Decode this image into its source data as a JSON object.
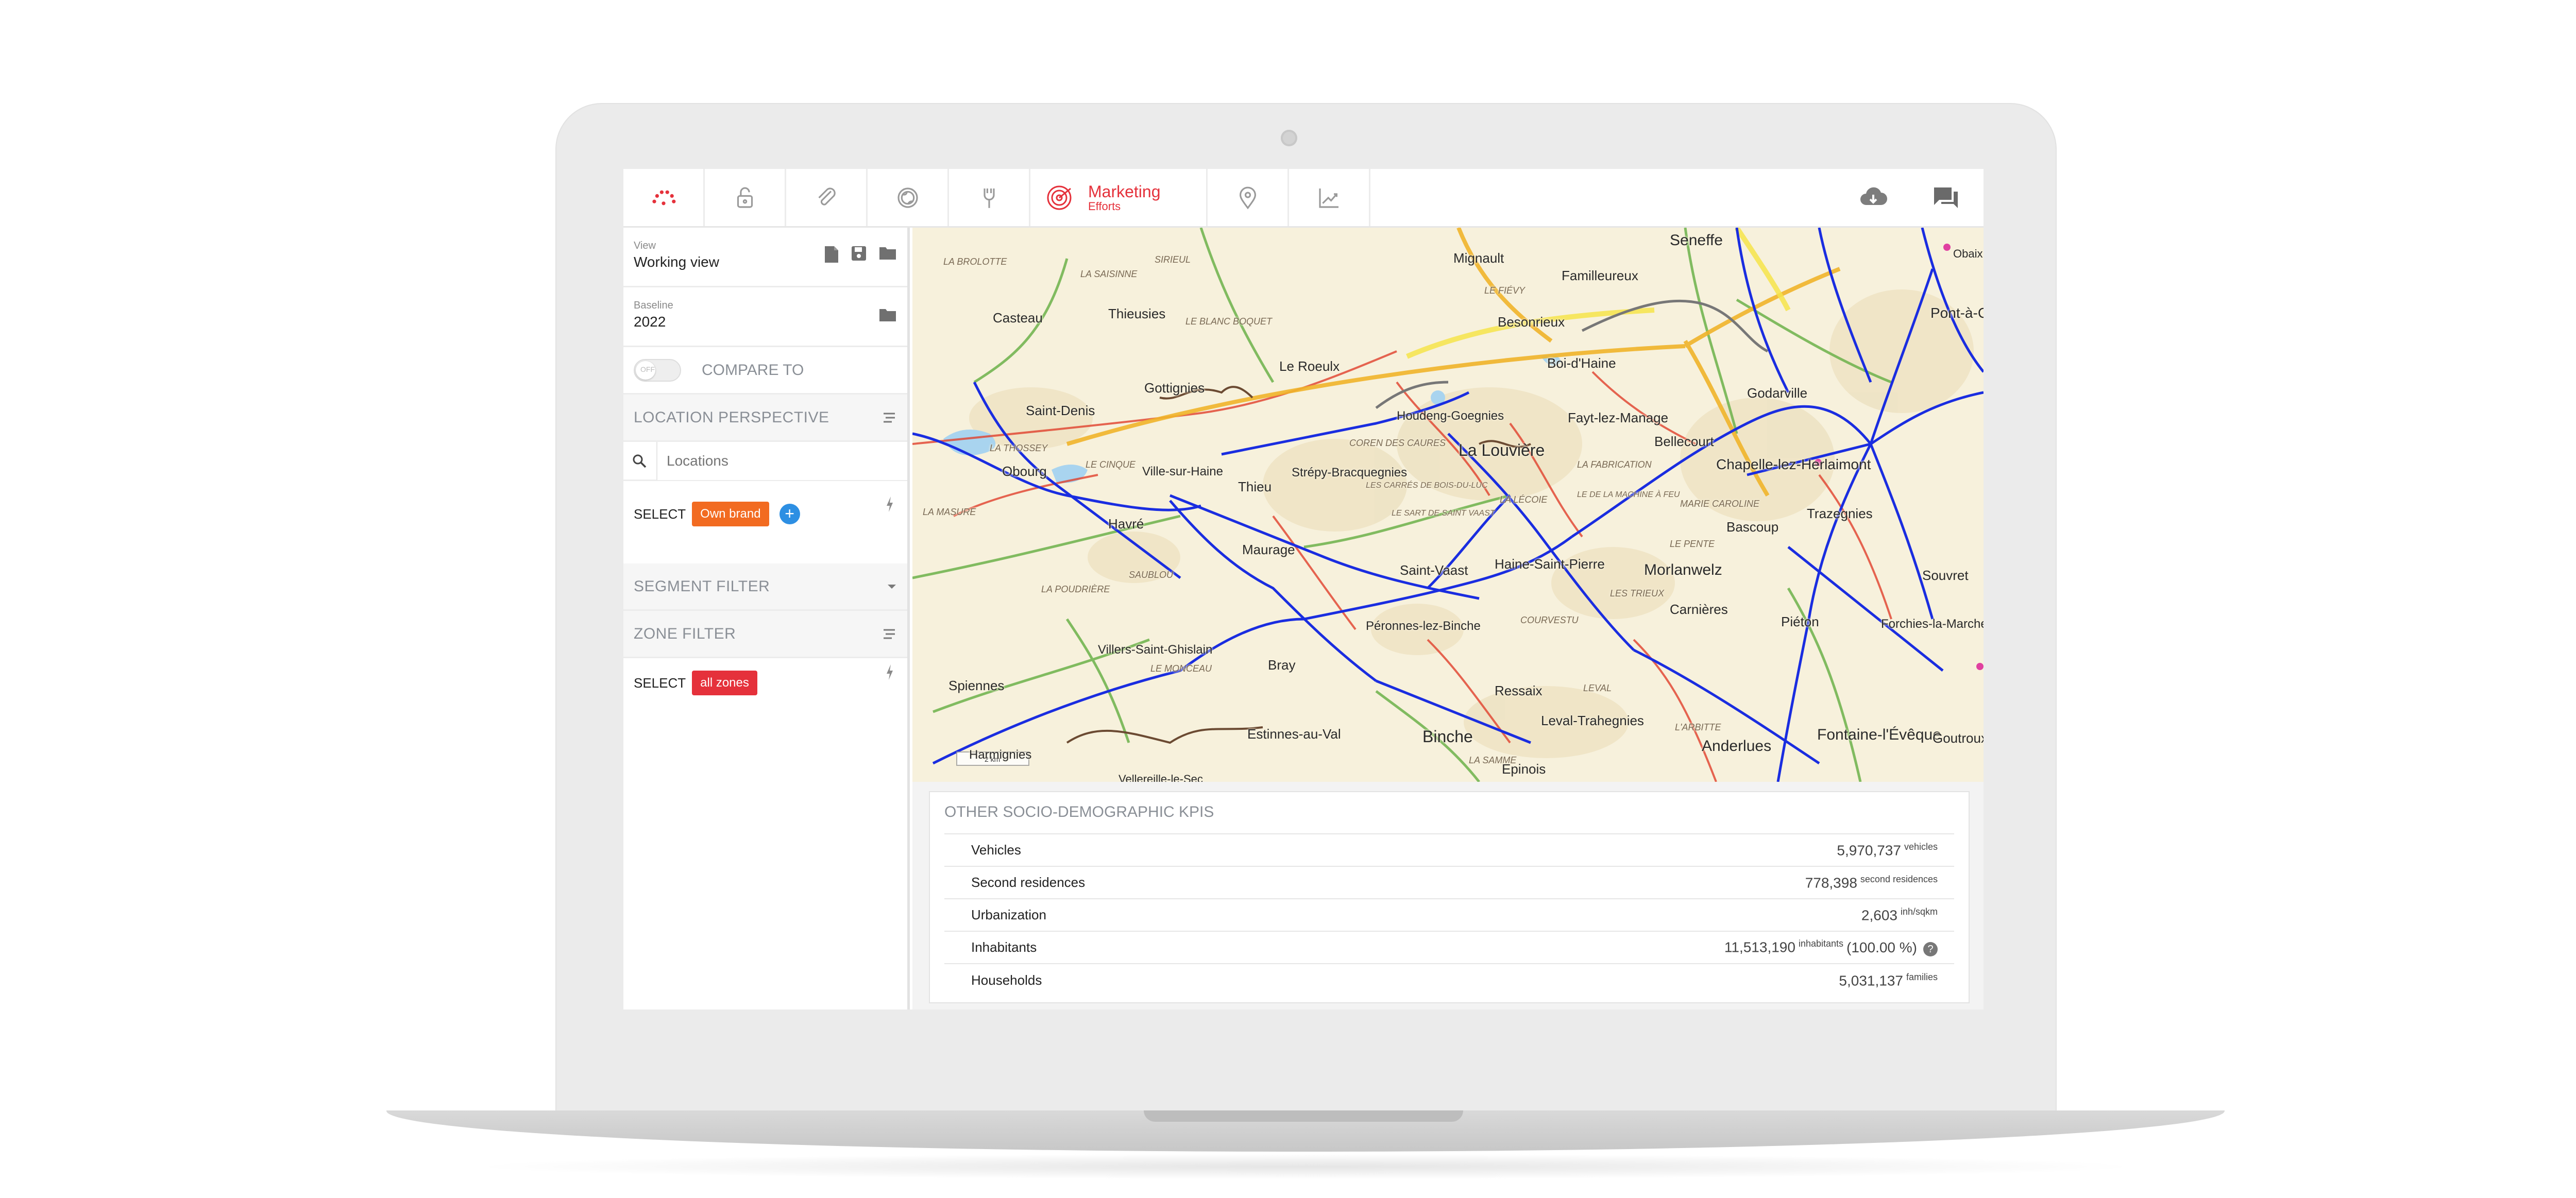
{
  "toolbar": {
    "active_label": "Marketing",
    "active_sub": "Efforts",
    "icons": [
      "logo-dots-icon",
      "lock-icon",
      "paperclip-icon",
      "globe-icon",
      "tools-icon",
      "marketing-target-icon",
      "location-pin-icon",
      "trend-chart-icon",
      "cloud-download-icon",
      "chat-icon"
    ]
  },
  "sidebar": {
    "view_label": "View",
    "view_value": "Working view",
    "baseline_label": "Baseline",
    "baseline_value": "2022",
    "toggle_state": "OFF",
    "compare_label": "COMPARE TO",
    "location_perspective": "LOCATION PERSPECTIVE",
    "search_placeholder": "Locations",
    "select_label": "SELECT",
    "brand_tag": "Own brand",
    "plus": "+",
    "segment_filter": "SEGMENT FILTER",
    "zone_filter": "ZONE FILTER",
    "zone_select_label": "SELECT",
    "zone_tag": "all zones"
  },
  "map": {
    "scale_label": "2 km",
    "places": [
      {
        "name": "Seneffe"
      },
      {
        "name": "Obaix"
      },
      {
        "name": "Pont-à-Celles"
      },
      {
        "name": "Mignault"
      },
      {
        "name": "Familleureux"
      },
      {
        "name": "LE FIÉVY"
      },
      {
        "name": "Besonrieux"
      },
      {
        "name": "Boi-d'Haine"
      },
      {
        "name": "Godarville"
      },
      {
        "name": "LA BROLOTTE"
      },
      {
        "name": "SIRIEUL"
      },
      {
        "name": "LA SAISINNE"
      },
      {
        "name": "Casteau"
      },
      {
        "name": "Thieusies"
      },
      {
        "name": "LE BLANC BOQUET"
      },
      {
        "name": "Le Roeulx"
      },
      {
        "name": "Gottignies"
      },
      {
        "name": "Houdeng-Goegnies"
      },
      {
        "name": "Fayt-lez-Manage"
      },
      {
        "name": "Saint-Denis"
      },
      {
        "name": "LA THOSSEY"
      },
      {
        "name": "Obourg"
      },
      {
        "name": "LE CINQUE"
      },
      {
        "name": "Ville-sur-Haine"
      },
      {
        "name": "Thieu"
      },
      {
        "name": "COREN DES CAURES"
      },
      {
        "name": "La Louvière"
      },
      {
        "name": "Bellecourt"
      },
      {
        "name": "Chapelle-lez-Herlaimont"
      },
      {
        "name": "Strépy-Bracquegnies"
      },
      {
        "name": "LES CARRÉS DE BOIS-DU-LUC"
      },
      {
        "name": "LA FABRICATION"
      },
      {
        "name": "LA MASURE"
      },
      {
        "name": "Havré"
      },
      {
        "name": "Maurage"
      },
      {
        "name": "LE SART DE SAINT VAAST"
      },
      {
        "name": "LA LÉCOIE"
      },
      {
        "name": "LE DE LA MACHINE À FEU"
      },
      {
        "name": "MARIE CAROLINE"
      },
      {
        "name": "Trazegnies"
      },
      {
        "name": "Bascoup"
      },
      {
        "name": "LE PENTE"
      },
      {
        "name": "SAUBLOU"
      },
      {
        "name": "LA POUDRIÈRE"
      },
      {
        "name": "Saint-Vaast"
      },
      {
        "name": "Haine-Saint-Pierre"
      },
      {
        "name": "Morlanwelz"
      },
      {
        "name": "Souvret"
      },
      {
        "name": "LES TRIEUX"
      },
      {
        "name": "Carnières"
      },
      {
        "name": "Piéton"
      },
      {
        "name": "Péronnes-lez-Binche"
      },
      {
        "name": "COURVESTU"
      },
      {
        "name": "Forchies-la-Marche"
      },
      {
        "name": "Villers-Saint-Ghislain"
      },
      {
        "name": "LE MONCEAU"
      },
      {
        "name": "Bray"
      },
      {
        "name": "Spiennes"
      },
      {
        "name": "Ressaix"
      },
      {
        "name": "LEVAL"
      },
      {
        "name": "Leval-Trahegnies"
      },
      {
        "name": "L'ARBITTE"
      },
      {
        "name": "Anderlues"
      },
      {
        "name": "Fontaine-l'Évêque"
      },
      {
        "name": "Goutroux"
      },
      {
        "name": "Estinnes-au-Val"
      },
      {
        "name": "Binche"
      },
      {
        "name": "LA SAMME"
      },
      {
        "name": "Epinois"
      },
      {
        "name": "Harmignies"
      },
      {
        "name": "Vellereille-le-Sec"
      }
    ]
  },
  "kpis": {
    "title": "OTHER SOCIO-DEMOGRAPHIC KPIS",
    "rows": [
      {
        "label": "Vehicles",
        "value": "5,970,737",
        "unit": "vehicles",
        "extra": ""
      },
      {
        "label": "Second residences",
        "value": "778,398",
        "unit": "second residences",
        "extra": ""
      },
      {
        "label": "Urbanization",
        "value": "2,603",
        "unit": "inh/sqkm",
        "extra": ""
      },
      {
        "label": "Inhabitants",
        "value": "11,513,190",
        "unit": "inhabitants",
        "extra": "(100.00 %)"
      },
      {
        "label": "Households",
        "value": "5,031,137",
        "unit": "families",
        "extra": ""
      }
    ]
  }
}
